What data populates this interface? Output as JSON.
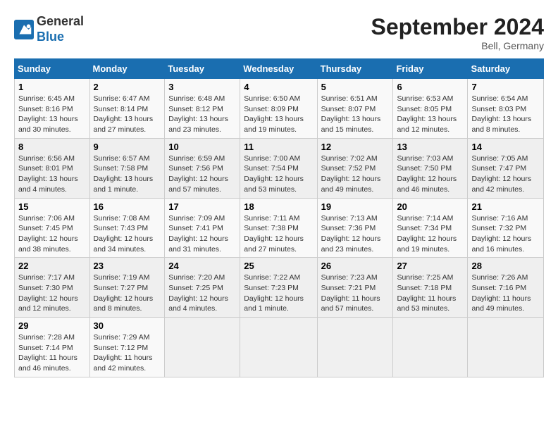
{
  "logo": {
    "general": "General",
    "blue": "Blue"
  },
  "title": "September 2024",
  "subtitle": "Bell, Germany",
  "days_of_week": [
    "Sunday",
    "Monday",
    "Tuesday",
    "Wednesday",
    "Thursday",
    "Friday",
    "Saturday"
  ],
  "weeks": [
    [
      {
        "day": "1",
        "details": "Sunrise: 6:45 AM\nSunset: 8:16 PM\nDaylight: 13 hours\nand 30 minutes."
      },
      {
        "day": "2",
        "details": "Sunrise: 6:47 AM\nSunset: 8:14 PM\nDaylight: 13 hours\nand 27 minutes."
      },
      {
        "day": "3",
        "details": "Sunrise: 6:48 AM\nSunset: 8:12 PM\nDaylight: 13 hours\nand 23 minutes."
      },
      {
        "day": "4",
        "details": "Sunrise: 6:50 AM\nSunset: 8:09 PM\nDaylight: 13 hours\nand 19 minutes."
      },
      {
        "day": "5",
        "details": "Sunrise: 6:51 AM\nSunset: 8:07 PM\nDaylight: 13 hours\nand 15 minutes."
      },
      {
        "day": "6",
        "details": "Sunrise: 6:53 AM\nSunset: 8:05 PM\nDaylight: 13 hours\nand 12 minutes."
      },
      {
        "day": "7",
        "details": "Sunrise: 6:54 AM\nSunset: 8:03 PM\nDaylight: 13 hours\nand 8 minutes."
      }
    ],
    [
      {
        "day": "8",
        "details": "Sunrise: 6:56 AM\nSunset: 8:01 PM\nDaylight: 13 hours\nand 4 minutes."
      },
      {
        "day": "9",
        "details": "Sunrise: 6:57 AM\nSunset: 7:58 PM\nDaylight: 13 hours\nand 1 minute."
      },
      {
        "day": "10",
        "details": "Sunrise: 6:59 AM\nSunset: 7:56 PM\nDaylight: 12 hours\nand 57 minutes."
      },
      {
        "day": "11",
        "details": "Sunrise: 7:00 AM\nSunset: 7:54 PM\nDaylight: 12 hours\nand 53 minutes."
      },
      {
        "day": "12",
        "details": "Sunrise: 7:02 AM\nSunset: 7:52 PM\nDaylight: 12 hours\nand 49 minutes."
      },
      {
        "day": "13",
        "details": "Sunrise: 7:03 AM\nSunset: 7:50 PM\nDaylight: 12 hours\nand 46 minutes."
      },
      {
        "day": "14",
        "details": "Sunrise: 7:05 AM\nSunset: 7:47 PM\nDaylight: 12 hours\nand 42 minutes."
      }
    ],
    [
      {
        "day": "15",
        "details": "Sunrise: 7:06 AM\nSunset: 7:45 PM\nDaylight: 12 hours\nand 38 minutes."
      },
      {
        "day": "16",
        "details": "Sunrise: 7:08 AM\nSunset: 7:43 PM\nDaylight: 12 hours\nand 34 minutes."
      },
      {
        "day": "17",
        "details": "Sunrise: 7:09 AM\nSunset: 7:41 PM\nDaylight: 12 hours\nand 31 minutes."
      },
      {
        "day": "18",
        "details": "Sunrise: 7:11 AM\nSunset: 7:38 PM\nDaylight: 12 hours\nand 27 minutes."
      },
      {
        "day": "19",
        "details": "Sunrise: 7:13 AM\nSunset: 7:36 PM\nDaylight: 12 hours\nand 23 minutes."
      },
      {
        "day": "20",
        "details": "Sunrise: 7:14 AM\nSunset: 7:34 PM\nDaylight: 12 hours\nand 19 minutes."
      },
      {
        "day": "21",
        "details": "Sunrise: 7:16 AM\nSunset: 7:32 PM\nDaylight: 12 hours\nand 16 minutes."
      }
    ],
    [
      {
        "day": "22",
        "details": "Sunrise: 7:17 AM\nSunset: 7:30 PM\nDaylight: 12 hours\nand 12 minutes."
      },
      {
        "day": "23",
        "details": "Sunrise: 7:19 AM\nSunset: 7:27 PM\nDaylight: 12 hours\nand 8 minutes."
      },
      {
        "day": "24",
        "details": "Sunrise: 7:20 AM\nSunset: 7:25 PM\nDaylight: 12 hours\nand 4 minutes."
      },
      {
        "day": "25",
        "details": "Sunrise: 7:22 AM\nSunset: 7:23 PM\nDaylight: 12 hours\nand 1 minute."
      },
      {
        "day": "26",
        "details": "Sunrise: 7:23 AM\nSunset: 7:21 PM\nDaylight: 11 hours\nand 57 minutes."
      },
      {
        "day": "27",
        "details": "Sunrise: 7:25 AM\nSunset: 7:18 PM\nDaylight: 11 hours\nand 53 minutes."
      },
      {
        "day": "28",
        "details": "Sunrise: 7:26 AM\nSunset: 7:16 PM\nDaylight: 11 hours\nand 49 minutes."
      }
    ],
    [
      {
        "day": "29",
        "details": "Sunrise: 7:28 AM\nSunset: 7:14 PM\nDaylight: 11 hours\nand 46 minutes."
      },
      {
        "day": "30",
        "details": "Sunrise: 7:29 AM\nSunset: 7:12 PM\nDaylight: 11 hours\nand 42 minutes."
      },
      {
        "day": "",
        "details": ""
      },
      {
        "day": "",
        "details": ""
      },
      {
        "day": "",
        "details": ""
      },
      {
        "day": "",
        "details": ""
      },
      {
        "day": "",
        "details": ""
      }
    ]
  ]
}
